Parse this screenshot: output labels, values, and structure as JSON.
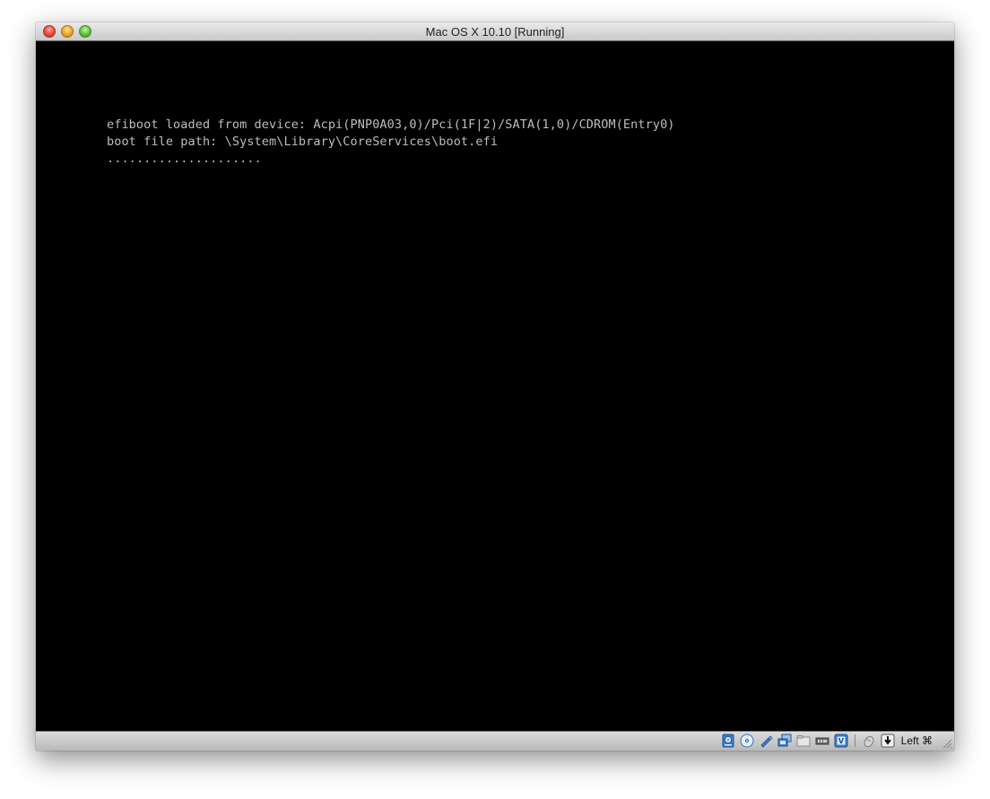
{
  "window": {
    "title": "Mac OS X 10.10 [Running]"
  },
  "console": {
    "lines": [
      "efiboot loaded from device: Acpi(PNP0A03,0)/Pci(1F|2)/SATA(1,0)/CDROM(Entry0)",
      "boot file path: \\System\\Library\\CoreServices\\boot.efi",
      "....................."
    ]
  },
  "statusbar": {
    "icons": [
      "hard-disk-icon",
      "optical-drive-icon",
      "usb-icon",
      "network-icon",
      "shared-folder-icon",
      "video-capture-icon",
      "virtualization-icon",
      "mouse-integration-icon",
      "keyboard-capture-icon"
    ],
    "host_key": "Left ⌘"
  },
  "colors": {
    "screen_bg": "#000000",
    "console_text": "#bdbdbd"
  }
}
